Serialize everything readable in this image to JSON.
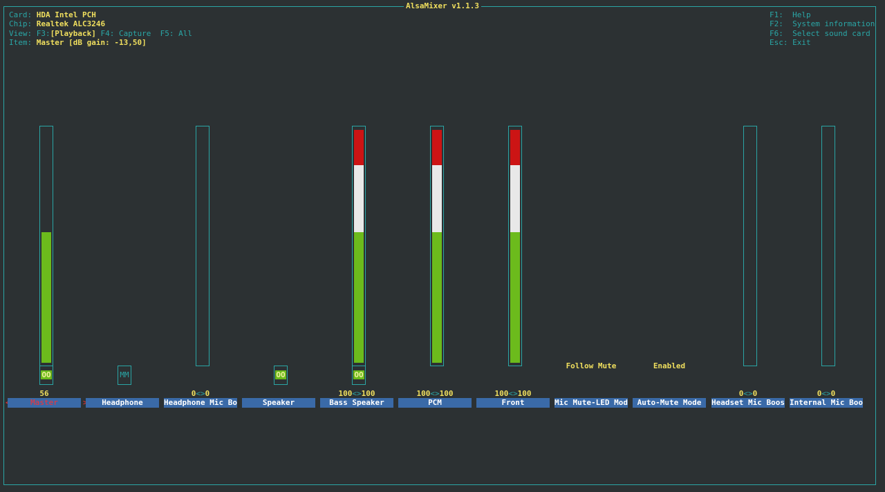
{
  "app": {
    "title": "AlsaMixer v1.1.3"
  },
  "header": {
    "card_label": "Card:",
    "card_value": "HDA Intel PCH",
    "chip_label": "Chip:",
    "chip_value": "Realtek ALC3246",
    "view_label": "View:",
    "view_f3": "F3:",
    "view_playback": "[Playback]",
    "view_f4": "F4: Capture",
    "view_f5": "F5: All",
    "item_label": "Item:",
    "item_value": "Master [dB gain: -13,50]"
  },
  "help": {
    "f1": "F1:  Help",
    "f2": "F2:  System information",
    "f6": "F6:  Select sound card",
    "esc": "Esc: Exit"
  },
  "colors": {
    "border": "#2aa6a6",
    "highlight": "#f0df5e",
    "label_bg": "#3a6aa8",
    "selected": "#ff3030"
  },
  "controls": [
    {
      "name": "Master",
      "level_percent": 56,
      "value": "56",
      "switch": "OO",
      "selected": true
    },
    {
      "name": "Headphone",
      "switch": "MM"
    },
    {
      "name": "Headphone Mic Boo",
      "level_percent": 0,
      "value_left": "0",
      "arrow": "<>",
      "value_right": "0"
    },
    {
      "name": "Speaker",
      "switch": "OO"
    },
    {
      "name": "Bass Speaker",
      "level_percent": 100,
      "value_left": "100",
      "arrow": "<>",
      "value_right": "100",
      "switch": "OO"
    },
    {
      "name": "PCM",
      "level_percent": 100,
      "value_left": "100",
      "arrow": "<>",
      "value_right": "100"
    },
    {
      "name": "Front",
      "level_percent": 100,
      "value_left": "100",
      "arrow": "<>",
      "value_right": "100"
    },
    {
      "name": "Mic Mute-LED Mode",
      "enum_value": "Follow Mute"
    },
    {
      "name": "Auto-Mute Mode",
      "enum_value": "Enabled"
    },
    {
      "name": "Headset Mic Boost",
      "level_percent": 0,
      "value_left": "0",
      "arrow": "<>",
      "value_right": "0"
    },
    {
      "name": "Internal Mic Boos",
      "level_percent": 0,
      "value_left": "0",
      "arrow": "<>",
      "value_right": "0"
    }
  ],
  "nav": {
    "left_marker": "<",
    "right_marker": ">"
  }
}
